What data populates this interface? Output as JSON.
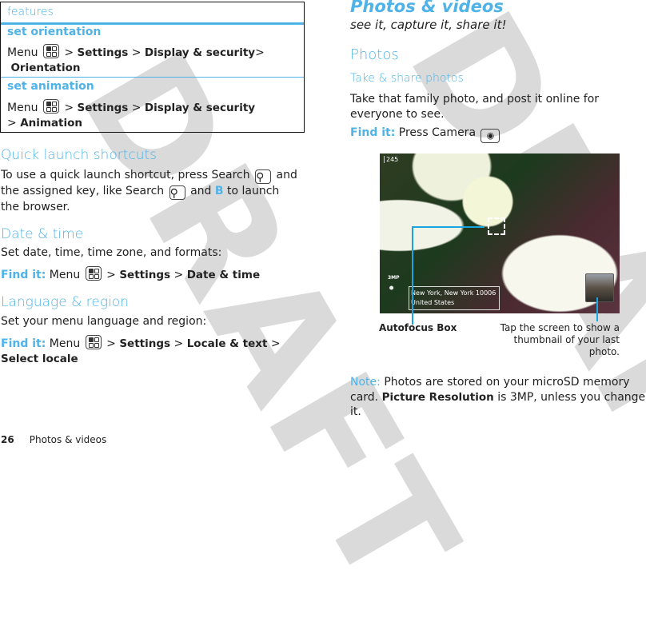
{
  "features_box": {
    "title": "features",
    "items": [
      {
        "heading": "set orientation",
        "prefix": "Menu",
        "path": [
          "Settings",
          "Display & security",
          "Orientation"
        ]
      },
      {
        "heading": "set animation",
        "prefix": "Menu",
        "path": [
          "Settings",
          "Display & security",
          "Animation"
        ]
      }
    ]
  },
  "quick_launch": {
    "heading": "Quick launch shortcuts",
    "text1": "To use a quick launch shortcut, press Search",
    "text2": "and the assigned key, like Search",
    "text3": "and",
    "key": "B",
    "text4": "to launch the browser."
  },
  "date_time": {
    "heading": "Date & time",
    "text": "Set date, time, time zone, and formats:",
    "find": "Find it:",
    "prefix": "Menu",
    "path": [
      "Settings",
      "Date & time"
    ]
  },
  "language": {
    "heading": "Language & region",
    "text": "Set your menu language and region:",
    "find": "Find it:",
    "prefix": "Menu",
    "path": [
      "Settings",
      "Locale & text",
      "Select locale"
    ]
  },
  "right": {
    "title": "Photos & videos",
    "subtitle": "see it, capture it, share it!",
    "section": "Photos",
    "subsection": "Take & share photos",
    "body": "Take that family photo, and post it online for everyone to see.",
    "find": "Find it:",
    "find_text": "Press Camera",
    "photo": {
      "counter": "245",
      "resolution": "3MP",
      "location1": "New York, New York 10006",
      "location2": "United States"
    },
    "caption_left": "Autofocus Box",
    "caption_right": "Tap the screen to show a thumbnail of your last photo.",
    "note_label": "Note:",
    "note_text": "Photos are stored on your microSD memory card.",
    "note_bold": "Picture Resolution",
    "note_end": "is 3MP, unless you change it."
  },
  "footer": {
    "page": "26",
    "section": "Photos & videos"
  },
  "watermark": "DRAFT",
  "colors": {
    "accent": "#4fb3e8"
  }
}
